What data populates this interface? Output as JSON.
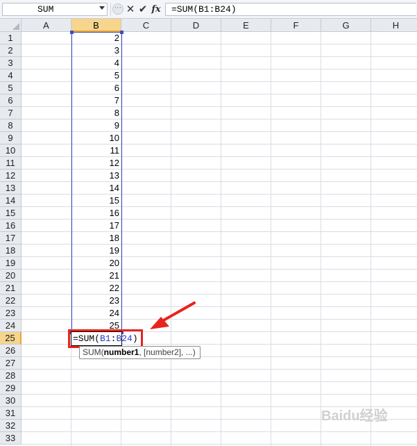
{
  "formula_bar": {
    "name_box": "SUM",
    "formula": "=SUM(B1:B24)",
    "icons": {
      "cancel": "cancel-x-icon",
      "enter": "checkmark-icon",
      "function": "fx-icon"
    },
    "cancel_glyph": "✕",
    "enter_glyph": "✔",
    "fx_glyph": "fx"
  },
  "grid": {
    "columns": [
      "A",
      "B",
      "C",
      "D",
      "E",
      "F",
      "G",
      "H"
    ],
    "selected_column": "B",
    "rows": [
      "1",
      "2",
      "3",
      "4",
      "5",
      "6",
      "7",
      "8",
      "9",
      "10",
      "11",
      "12",
      "13",
      "14",
      "15",
      "16",
      "17",
      "18",
      "19",
      "20",
      "21",
      "22",
      "23",
      "24",
      "25",
      "26",
      "27",
      "28",
      "29",
      "30",
      "31",
      "32",
      "33"
    ],
    "selected_row": "25",
    "b_values": [
      "2",
      "3",
      "4",
      "5",
      "6",
      "7",
      "8",
      "9",
      "10",
      "11",
      "12",
      "13",
      "14",
      "15",
      "16",
      "17",
      "18",
      "19",
      "20",
      "21",
      "22",
      "23",
      "24",
      "25"
    ]
  },
  "edit_cell": {
    "prefix": "=SUM(",
    "ref_start": "B1",
    "colon": ":",
    "ref_end": "B24",
    "suffix": ")"
  },
  "tooltip": {
    "func": "SUM(",
    "arg1": "number1",
    "rest": ", [number2], ...)"
  },
  "watermark": "Baidu经验",
  "colors": {
    "highlight_box": "#e8231d",
    "range_border": "#3e4fc8",
    "selected_header": "#f6d58d"
  }
}
